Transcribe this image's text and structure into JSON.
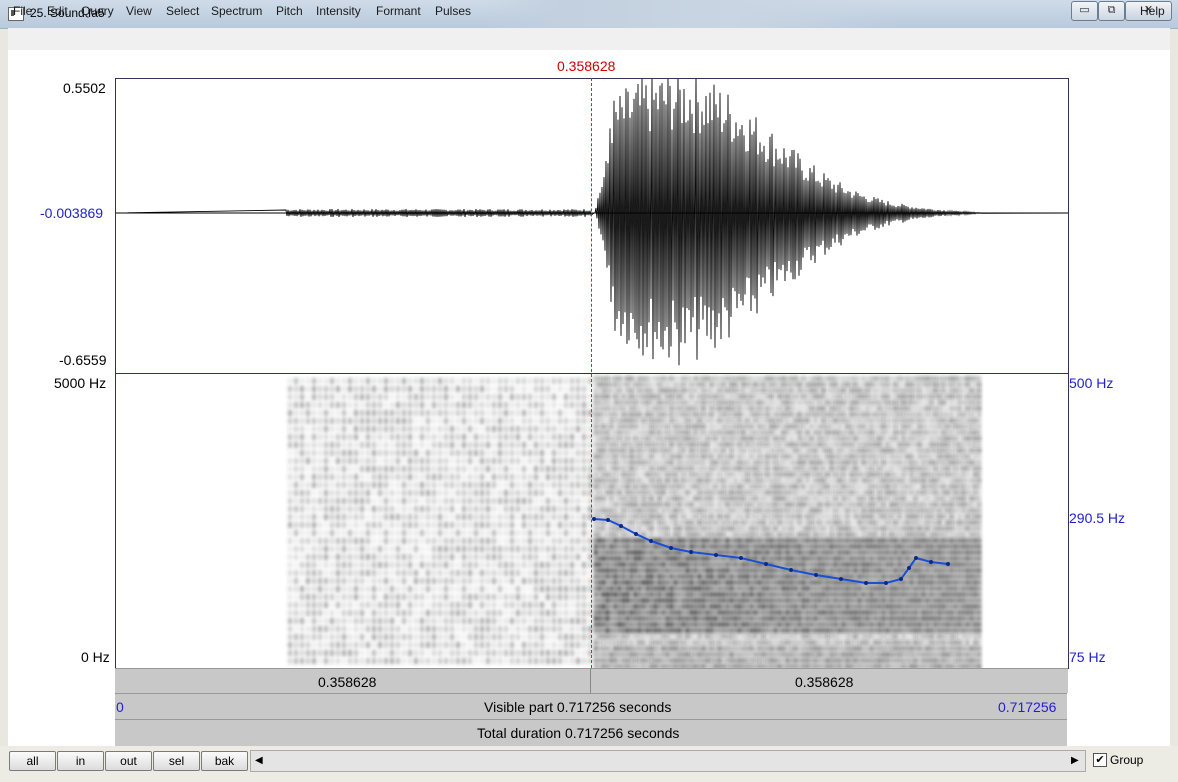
{
  "window": {
    "title": "25. Sound fa5",
    "minimize_glyph": "▭",
    "maximize_glyph": "⧉",
    "close_glyph": "✕"
  },
  "menu": {
    "items": [
      "File",
      "Edit",
      "Query",
      "View",
      "Select",
      "Spectrum",
      "Pitch",
      "Intensity",
      "Formant",
      "Pulses"
    ],
    "help": "Help"
  },
  "cursor": {
    "time_label": "0.358628",
    "color": "#cc0000"
  },
  "waveform": {
    "y_max": "0.5502",
    "y_zero": "-0.003869",
    "y_min": "-0.6559"
  },
  "spectrogram": {
    "freq_max": "5000 Hz",
    "freq_min": "0 Hz",
    "pitch_max": "500 Hz",
    "pitch_cursor": "290.5 Hz",
    "pitch_min": "75 Hz",
    "pitch_color": "#1a4fd6"
  },
  "time_bars": {
    "left_segment": "0.358628",
    "right_segment": "0.358628",
    "visible_start": "0",
    "visible_text": "Visible part 0.717256 seconds",
    "visible_end": "0.717256",
    "total_text": "Total duration 0.717256 seconds"
  },
  "buttons": {
    "all": "all",
    "in": "in",
    "out": "out",
    "sel": "sel",
    "bak": "bak"
  },
  "scroll": {
    "left_arrow": "◀",
    "right_arrow": "▶"
  },
  "group": {
    "label": "Group",
    "checked": true,
    "check_glyph": "✔"
  }
}
